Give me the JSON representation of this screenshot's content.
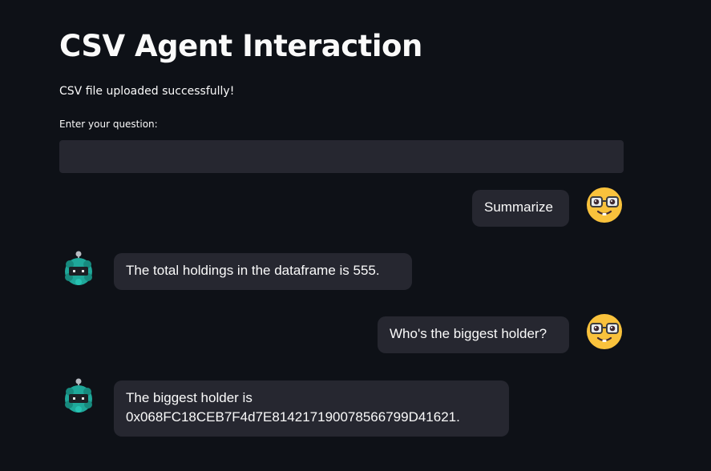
{
  "page": {
    "title": "CSV Agent Interaction",
    "status_message": "CSV file uploaded successfully!"
  },
  "question_input": {
    "label": "Enter your question:",
    "value": "",
    "placeholder": ""
  },
  "chat": {
    "messages": [
      {
        "role": "user",
        "text": "Summarize",
        "avatar_icon": "nerd-face-icon"
      },
      {
        "role": "assistant",
        "text": "The total holdings in the dataframe is 555.",
        "avatar_icon": "robot-icon"
      },
      {
        "role": "user",
        "text": "Who's the biggest holder?",
        "avatar_icon": "nerd-face-icon"
      },
      {
        "role": "assistant",
        "text_line1": "The biggest holder is",
        "text_line2": "0x068FC18CEB7F4d7E814217190078566799D41621.",
        "avatar_icon": "robot-icon"
      }
    ]
  },
  "colors": {
    "background": "#0e1117",
    "bubble": "#262730",
    "input": "#262730",
    "text": "#fafafa",
    "user_avatar": "#f9c23c",
    "bot_avatar": "#1fa89a"
  }
}
